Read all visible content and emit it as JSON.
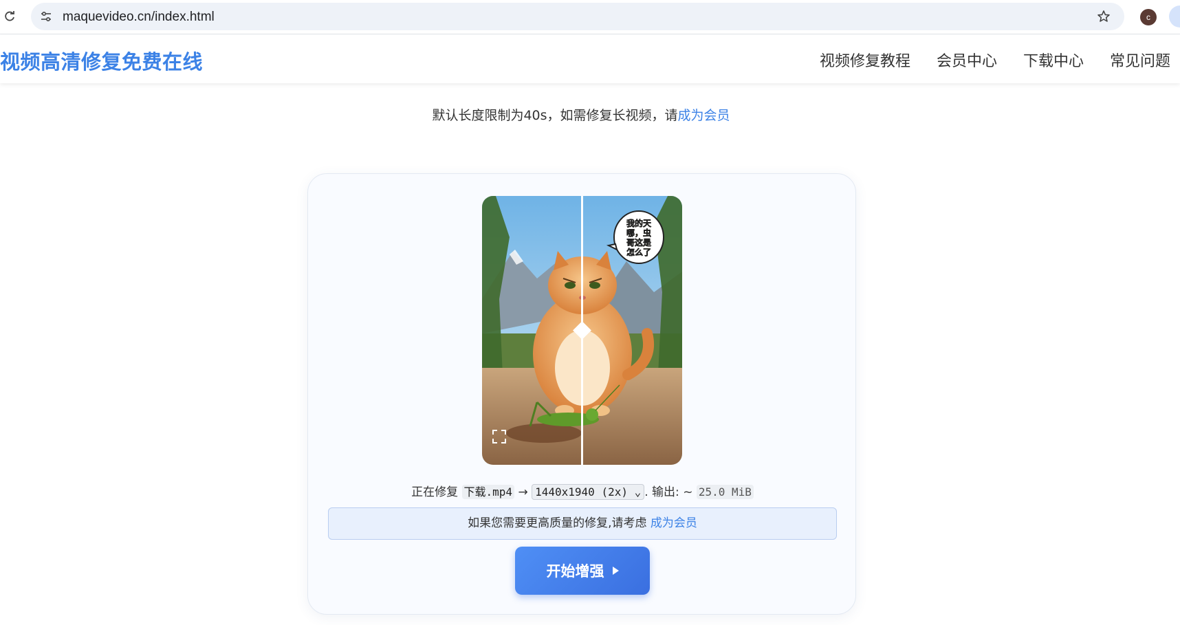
{
  "browser": {
    "url": "maquevideo.cn/index.html",
    "profile_initial": "c"
  },
  "header": {
    "logo": "视频高清修复免费在线",
    "nav": [
      {
        "label": "视频修复教程"
      },
      {
        "label": "会员中心"
      },
      {
        "label": "下载中心"
      },
      {
        "label": "常见问题"
      }
    ]
  },
  "notice": {
    "text": "默认长度限制为40s，如需修复长视频，请",
    "link": "成为会员"
  },
  "preview": {
    "speech_bubble": [
      "我的天",
      "哪，虫",
      "哥这是",
      "怎么了"
    ],
    "icons": [
      "fullscreen-icon",
      "compare-handle-icon"
    ]
  },
  "status": {
    "prefix": "正在修复",
    "filename": "下载.mp4",
    "arrow": "→",
    "resolution": "1440x1940 (2x)",
    "output_label": ". 输出: ~",
    "output_size": "25.0 MiB"
  },
  "upsell": {
    "text": "如果您需要更高质量的修复,请考虑",
    "link": "成为会员"
  },
  "start_button": {
    "label": "开始增强"
  },
  "colors": {
    "accent": "#3c82e6",
    "button": "#3a6fe0",
    "upsell_bg": "#e8f0fd"
  }
}
